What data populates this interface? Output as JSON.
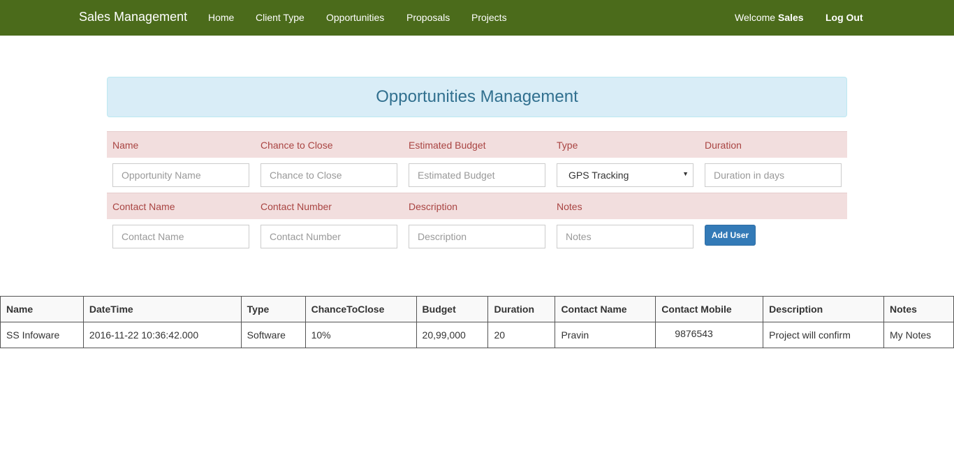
{
  "navbar": {
    "brand": "Sales Management",
    "links": [
      "Home",
      "Client Type",
      "Opportunities",
      "Proposals",
      "Projects"
    ],
    "welcome_prefix": "Welcome",
    "user": "Sales",
    "logout": "Log Out",
    "color": "#4b6b1b"
  },
  "page_title": "Opportunities Management",
  "form": {
    "row1_labels": [
      "Name",
      "Chance to Close",
      "Estimated Budget",
      "Type",
      "Duration"
    ],
    "row1_placeholders": {
      "name": "Opportunity Name",
      "chance": "Chance to Close",
      "budget": "Estimated Budget",
      "duration": "Duration in days"
    },
    "type_selected": "GPS Tracking",
    "row2_labels": [
      "Contact Name",
      "Contact Number",
      "Description",
      "Notes"
    ],
    "row2_placeholders": {
      "contact_name": "Contact Name",
      "contact_number": "Contact Number",
      "description": "Description",
      "notes": "Notes"
    },
    "submit_label": "Add User"
  },
  "table": {
    "columns": [
      "Name",
      "DateTime",
      "Type",
      "ChanceToClose",
      "Budget",
      "Duration",
      "Contact Name",
      "Contact Mobile",
      "Description",
      "Notes"
    ],
    "rows": [
      [
        "SS Infoware",
        "2016-11-22 10:36:42.000",
        "Software",
        "10%",
        "20,99,000",
        "20",
        "Pravin",
        "9876543",
        "Project will confirm",
        "My Notes"
      ]
    ]
  }
}
